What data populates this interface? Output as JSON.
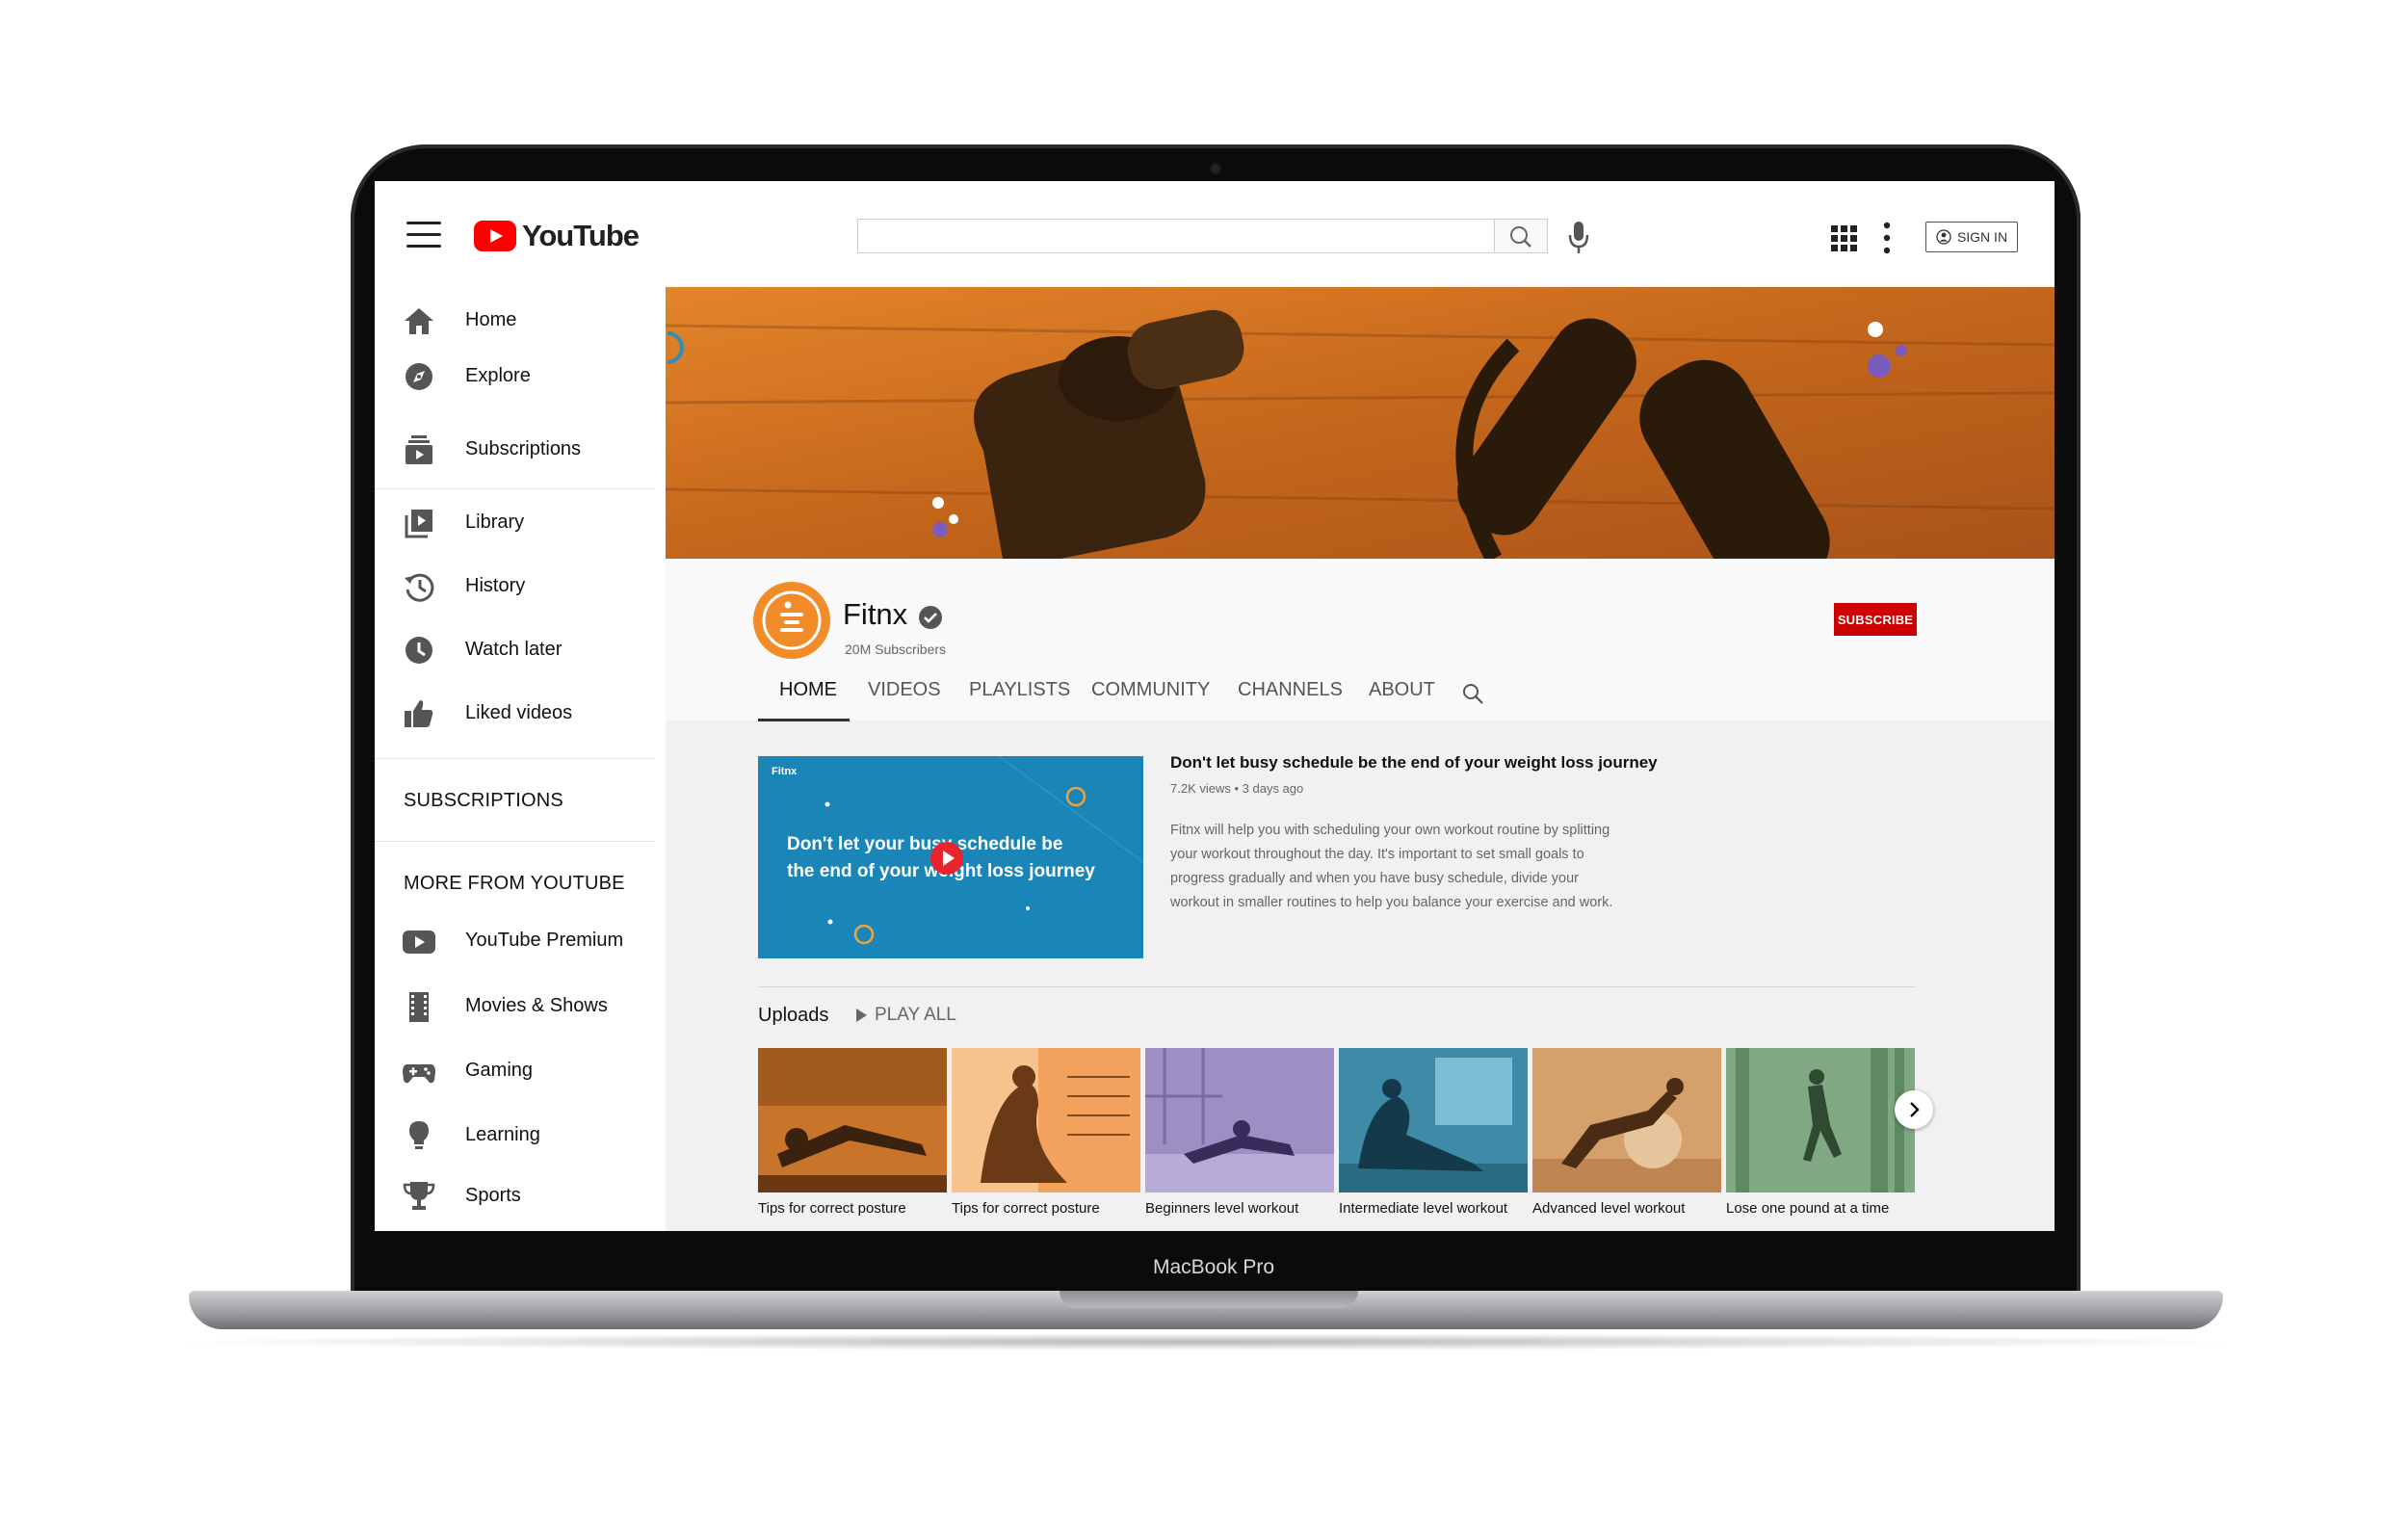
{
  "device": {
    "label": "MacBook Pro"
  },
  "header": {
    "logo_text": "YouTube",
    "search": {
      "value": "",
      "placeholder": ""
    },
    "sign_in_label": "SIGN IN"
  },
  "sidebar": {
    "primary": [
      {
        "label": "Home",
        "icon": "home-icon"
      },
      {
        "label": "Explore",
        "icon": "compass-icon"
      },
      {
        "label": "Subscriptions",
        "icon": "subscriptions-icon"
      }
    ],
    "library": [
      {
        "label": "Library",
        "icon": "library-icon"
      },
      {
        "label": "History",
        "icon": "history-icon"
      },
      {
        "label": "Watch later",
        "icon": "clock-icon"
      },
      {
        "label": "Liked videos",
        "icon": "thumbs-up-icon"
      }
    ],
    "subscriptions_title": "SUBSCRIPTIONS",
    "more_title": "MORE FROM YOUTUBE",
    "more": [
      {
        "label": "YouTube Premium",
        "icon": "youtube-premium-icon"
      },
      {
        "label": "Movies & Shows",
        "icon": "film-icon"
      },
      {
        "label": "Gaming",
        "icon": "gamepad-icon"
      },
      {
        "label": "Learning",
        "icon": "lightbulb-icon"
      },
      {
        "label": "Sports",
        "icon": "trophy-icon"
      }
    ]
  },
  "channel": {
    "name": "Fitnx",
    "subscribers": "20M Subscribers",
    "subscribe_label": "SUBSCRIBE",
    "brand_color": "#f28c28",
    "tabs": [
      "HOME",
      "VIDEOS",
      "PLAYLISTS",
      "COMMUNITY",
      "CHANNELS",
      "ABOUT"
    ],
    "active_tab": "HOME"
  },
  "featured": {
    "thumb_logo": "Fitnx",
    "thumb_headline": "Don't let your busy schedule be the end of your weight loss journey",
    "title": "Don't let busy schedule be the end of your weight loss journey",
    "meta": "7.2K views • 3 days ago",
    "description": "Fitnx will help you with scheduling your own workout routine by splitting your workout throughout the day. It's important to set small goals to progress gradually and when you have busy schedule, divide your workout in smaller routines to help you balance your exercise and work."
  },
  "uploads": {
    "title": "Uploads",
    "play_all": "PLAY ALL",
    "videos": [
      {
        "title": "Tips for correct posture",
        "tint": "#c8742a"
      },
      {
        "title": "Tips for correct posture",
        "tint": "#f2a25c"
      },
      {
        "title": "Beginners level workout",
        "tint": "#9d8fc4"
      },
      {
        "title": "Intermediate level workout",
        "tint": "#3f8aa6"
      },
      {
        "title": "Advanced level workout",
        "tint": "#d6a06a"
      },
      {
        "title": "Lose one pound at a time",
        "tint": "#7fa883"
      }
    ]
  }
}
